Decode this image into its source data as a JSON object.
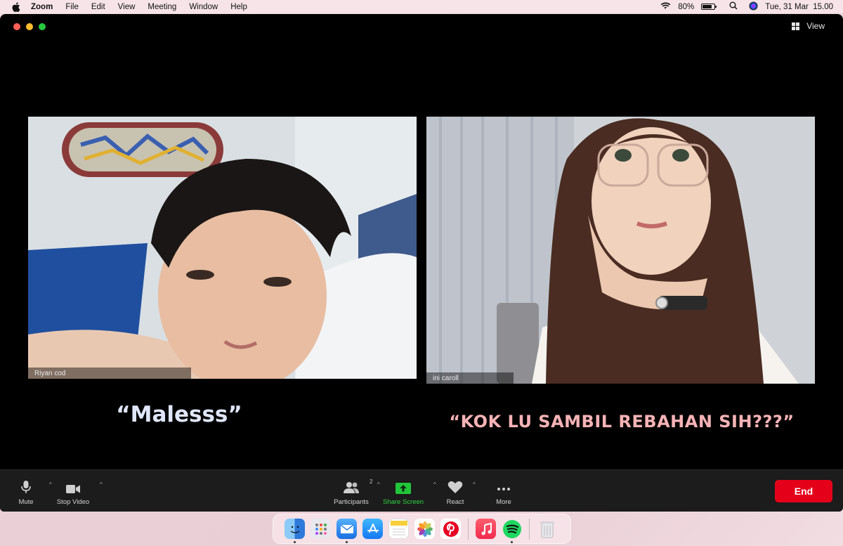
{
  "menubar": {
    "app_name": "Zoom",
    "menus": [
      "File",
      "Edit",
      "View",
      "Meeting",
      "Window",
      "Help"
    ],
    "battery_percent": "80%",
    "battery_level": 0.8,
    "datetime": "Tue, 31 Mar  15.00"
  },
  "window": {
    "view_label": "View"
  },
  "participants": [
    {
      "name": "Riyan cod"
    },
    {
      "name": "ini caroll"
    }
  ],
  "captions": {
    "left": "“Malesss”",
    "right": "“KOK LU SAMBIL REBAHAN SIH???”",
    "left_color": "#dfe6fb",
    "right_color": "#f6b3b6"
  },
  "toolbar": {
    "mute": "Mute",
    "stop_video": "Stop Video",
    "participants": "Participants",
    "participants_count": "2",
    "share_screen": "Share Screen",
    "react": "React",
    "more": "More",
    "end": "End",
    "end_color": "#e5001a",
    "share_color": "#2ed443"
  },
  "dock": {
    "apps": [
      "finder-icon",
      "launchpad-icon",
      "mail-icon",
      "app-store-icon",
      "notes-icon",
      "photos-icon",
      "pinterest-icon",
      "music-icon",
      "spotify-icon",
      "trash-icon"
    ]
  }
}
